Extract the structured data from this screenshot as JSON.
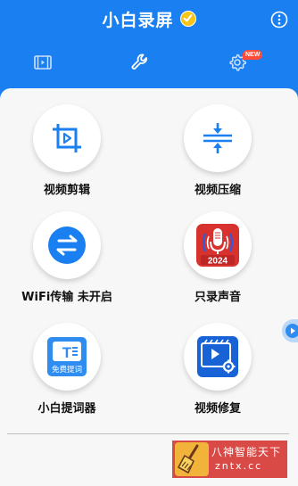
{
  "header": {
    "title": "小白录屏",
    "more_icon": "more-vertical-icon",
    "badge_icon": "verified-check-icon"
  },
  "tabs": [
    {
      "id": "video",
      "icon": "video-film-icon",
      "selected": false
    },
    {
      "id": "tools",
      "icon": "wrench-icon",
      "selected": true
    },
    {
      "id": "settings",
      "icon": "gear-icon",
      "selected": false,
      "badge": "NEW"
    }
  ],
  "tools": [
    {
      "label": "视频剪辑",
      "icon": "crop-video-icon"
    },
    {
      "label": "视频压缩",
      "icon": "compress-icon"
    },
    {
      "label": "WiFi传输 未开启",
      "icon": "transfer-arrows-icon"
    },
    {
      "label": "只录声音",
      "icon": "microphone-icon",
      "icon_text": "2024"
    },
    {
      "label": "小白提词器",
      "icon": "teleprompter-icon",
      "icon_text": "免费提词"
    },
    {
      "label": "视频修复",
      "icon": "video-repair-icon"
    }
  ],
  "watermark": {
    "line1": "八神智能天下",
    "line2": "zntx.cc"
  },
  "colors": {
    "primary": "#1a7ff0",
    "badge_yellow": "#f5c518",
    "new_badge": "#ff4b3a",
    "mic_red": "#d8322f",
    "repair_blue": "#1763d6",
    "watermark_red": "#d94a47"
  }
}
